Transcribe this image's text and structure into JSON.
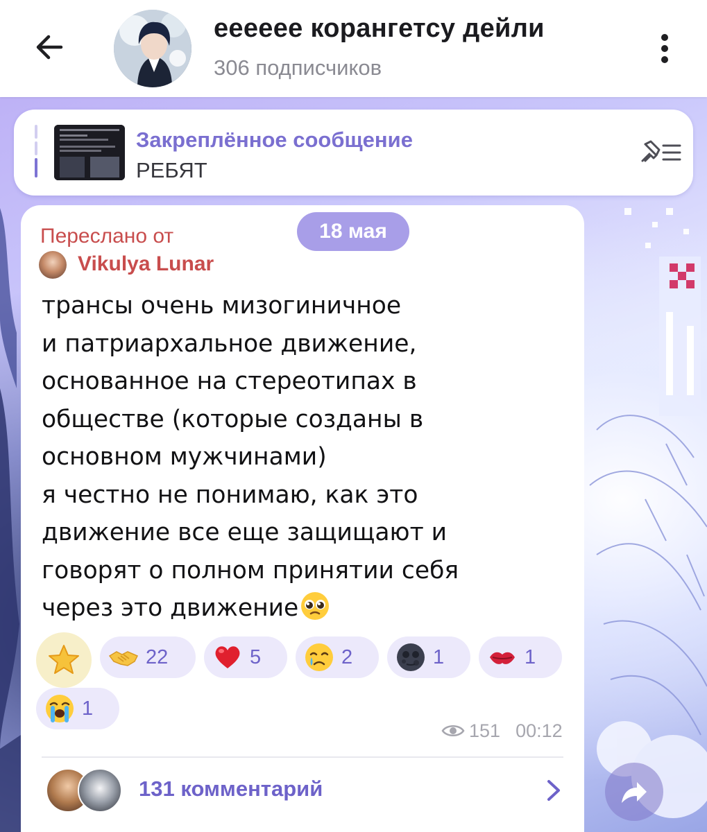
{
  "header": {
    "back_icon": "arrow-left-icon",
    "channel_title": "ееееее корангетсу дейли",
    "subscribers": "306 подписчиков",
    "menu_icon": "kebab-menu-icon"
  },
  "pinned": {
    "title": "Закреплённое сообщение",
    "text": "РЕБЯТ",
    "list_icon": "pin-list-icon"
  },
  "date_pill": "18 мая",
  "message": {
    "forwarded_label": "Переслано от",
    "forwarded_from": "Vikulya Lunar",
    "lines": [
      "трансы очень мизогиничное",
      "и патриархальное движение,",
      "основанное на стереотипах в",
      "обществе (которые созданы в",
      "основном мужчинами)",
      "я честно не понимаю, как это",
      "движение все еще защищают и",
      "говорят о полном принятии себя",
      "через это движение"
    ],
    "trailing_emoji": "pleading-face-emoji",
    "views": "151",
    "time": "00:12",
    "comments_label": "131 комментарий"
  },
  "reactions": [
    {
      "icon": "star-icon",
      "count": ""
    },
    {
      "icon": "handshake-emoji",
      "count": "22"
    },
    {
      "icon": "red-heart-emoji",
      "count": "5"
    },
    {
      "icon": "crying-face-emoji",
      "count": "2"
    },
    {
      "icon": "new-moon-face-emoji",
      "count": "1"
    },
    {
      "icon": "kiss-mark-emoji",
      "count": "1"
    },
    {
      "icon": "loudly-crying-face-emoji",
      "count": "1"
    }
  ],
  "colors": {
    "accent": "#6d62c9",
    "forward_name": "#c84d4d",
    "date_pill": "#a89ee8",
    "reaction_bg": "#ece9fb"
  }
}
